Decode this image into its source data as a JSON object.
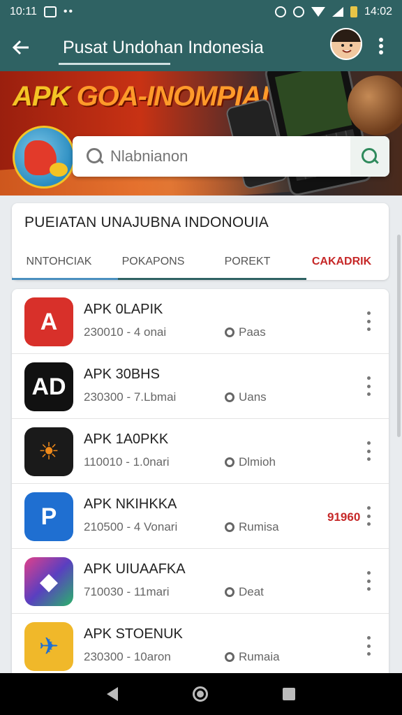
{
  "status_bar": {
    "time": "10:11",
    "battery": "14:02"
  },
  "app_bar": {
    "back_icon": "arrow-left-icon",
    "title": "Pusat Undohan Indonesia",
    "more_icon": "more-vert-icon"
  },
  "banner": {
    "headline_part1": "APK",
    "headline_part2": " GOA-INOMPIAI"
  },
  "search": {
    "placeholder": "Nlabnianon",
    "button_icon": "search-icon"
  },
  "section": {
    "title": "PUEIATAN UNAJUBNA INDONOUIA",
    "tabs": [
      {
        "label": "NNTOHCIAK",
        "active": false
      },
      {
        "label": "POKAPONS",
        "active": false
      },
      {
        "label": "POREKT",
        "active": false
      },
      {
        "label": "CAKADRIK",
        "active": true
      }
    ]
  },
  "apps": [
    {
      "name": "APK 0LAPIK",
      "meta": "230010 - 4 onai",
      "category": "Paas",
      "price": "",
      "icon_color": "#d8302a",
      "icon_glyph": "A"
    },
    {
      "name": "APK 30BHS",
      "meta": "230300 - 7.Lbmai",
      "category": "Uans",
      "price": "",
      "icon_color": "#111111",
      "icon_glyph": "AD"
    },
    {
      "name": "APK 1A0PKK",
      "meta": "110010 - 1.0nari",
      "category": "Dlmioh",
      "price": "",
      "icon_color": "#1a1a1a",
      "icon_glyph": "☀"
    },
    {
      "name": "APK NKIHKKA",
      "meta": "210500 - 4 Vonari",
      "category": "Rumisa",
      "price": "91960",
      "icon_color": "#1f6fd1",
      "icon_glyph": "P"
    },
    {
      "name": "APK UIUAAFKA",
      "meta": "710030 - 11mari",
      "category": "Deat",
      "price": "",
      "icon_color": "#5a3fc0",
      "icon_glyph": "◆"
    },
    {
      "name": "APK STOENUK",
      "meta": "230300 - 10aron",
      "category": "Rumaia",
      "price": "",
      "icon_color": "#f0b82a",
      "icon_glyph": "✈"
    }
  ],
  "nav_bar": {
    "back_icon": "nav-back-icon",
    "home_icon": "nav-home-icon",
    "recent_icon": "nav-recent-icon"
  }
}
